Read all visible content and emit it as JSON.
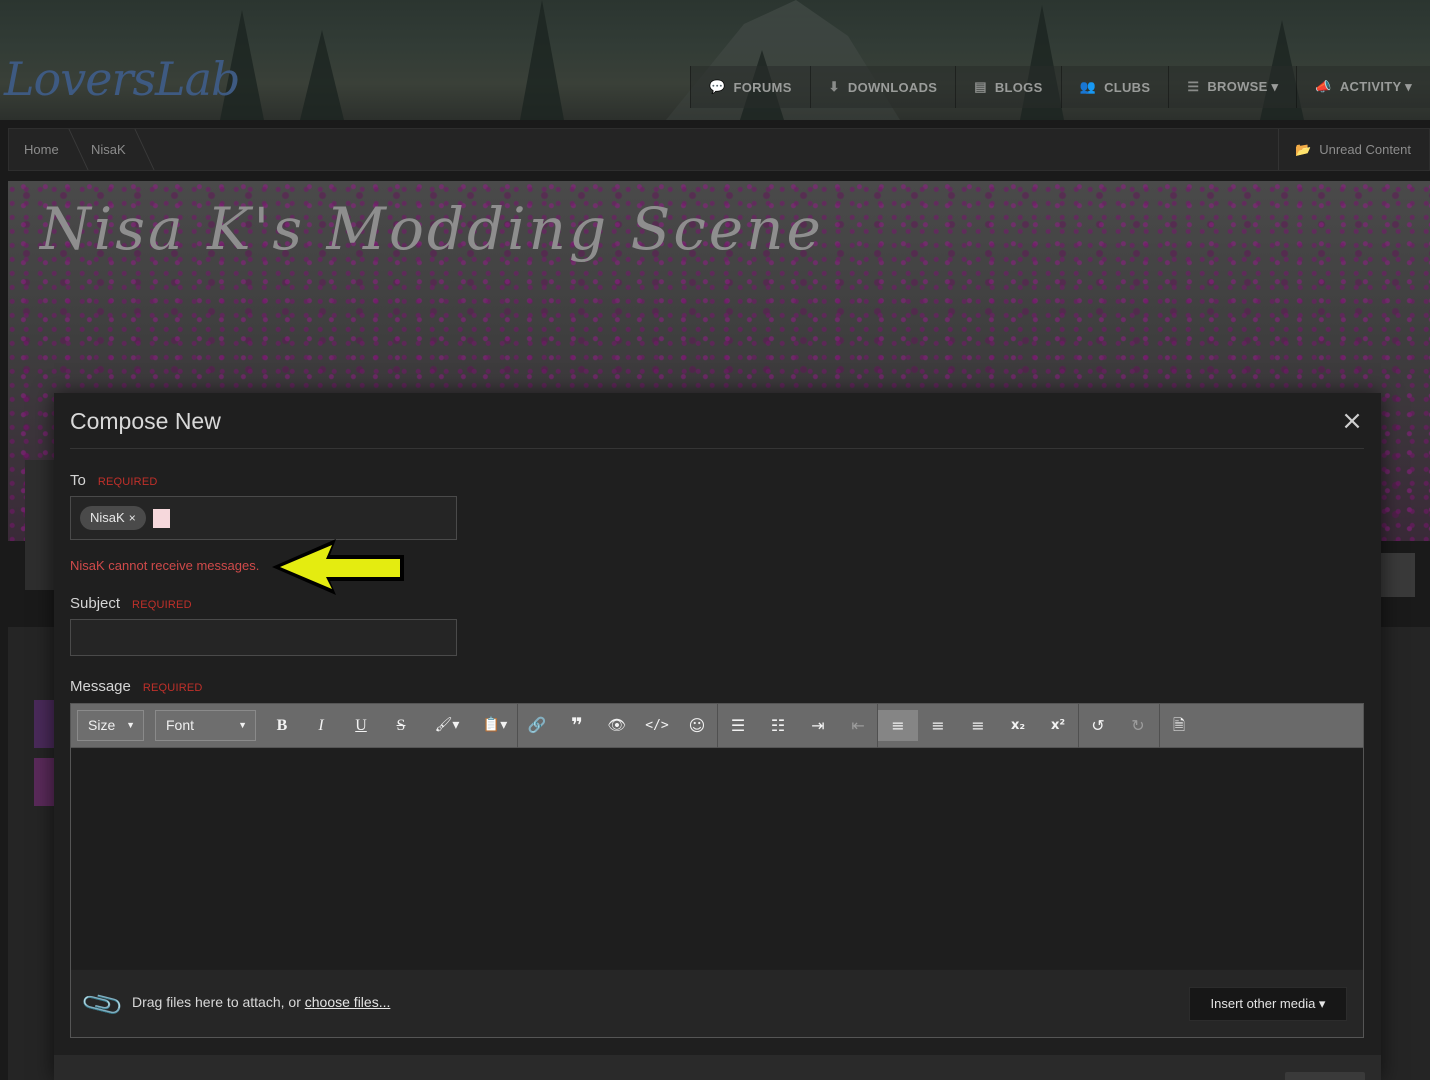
{
  "site": {
    "logo": "LoversLab",
    "nav": [
      {
        "label": "FORUMS",
        "icon": "comments-icon",
        "glyph": "💬"
      },
      {
        "label": "DOWNLOADS",
        "icon": "download-icon",
        "glyph": "⬇"
      },
      {
        "label": "BLOGS",
        "icon": "blog-icon",
        "glyph": "▤"
      },
      {
        "label": "CLUBS",
        "icon": "users-icon",
        "glyph": "👥"
      },
      {
        "label": "BROWSE ▾",
        "icon": "list-icon",
        "glyph": "☰"
      },
      {
        "label": "ACTIVITY ▾",
        "icon": "megaphone-icon",
        "glyph": "📣"
      }
    ]
  },
  "breadcrumb": {
    "items": [
      "Home",
      "NisaK"
    ],
    "unread": "Unread Content"
  },
  "banner": {
    "title": "Nisa K's Modding Scene"
  },
  "modal": {
    "title": "Compose New",
    "to": {
      "label": "To",
      "required": "REQUIRED",
      "recipient": "NisaK",
      "remove": "×"
    },
    "error": "NisaK cannot receive messages.",
    "subject": {
      "label": "Subject",
      "required": "REQUIRED",
      "value": ""
    },
    "message": {
      "label": "Message",
      "required": "REQUIRED"
    },
    "toolbar": {
      "size": "Size",
      "font": "Font"
    },
    "attach": {
      "text": "Drag files here to attach, or ",
      "link": "choose files..."
    },
    "insert_media": "Insert other media ▾"
  },
  "colors": {
    "error": "#d04a4a",
    "required": "#c0302a",
    "arrow": "#e4ec10"
  }
}
